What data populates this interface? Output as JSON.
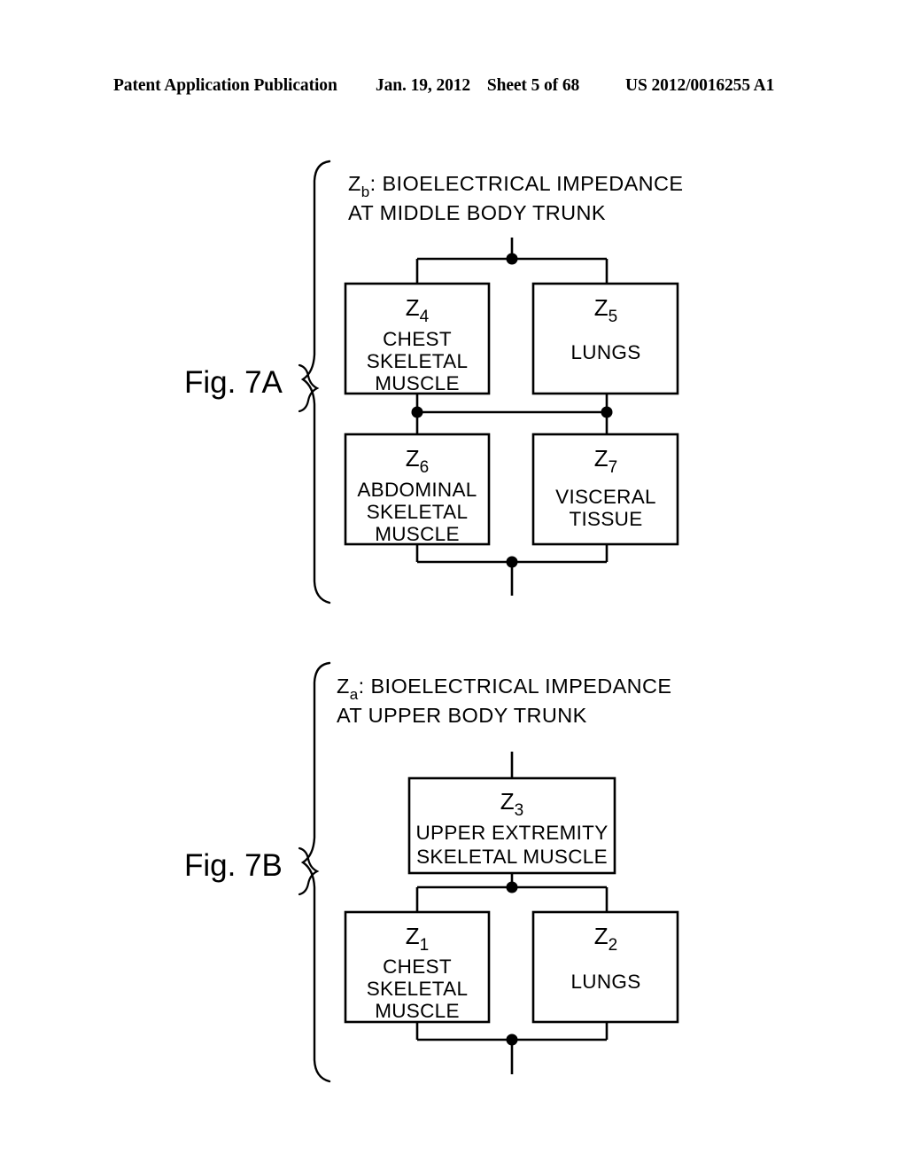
{
  "header": {
    "publication": "Patent Application Publication",
    "date": "Jan. 19, 2012",
    "sheet": "Sheet 5 of 68",
    "patent_number": "US 2012/0016255 A1"
  },
  "figures": [
    {
      "id": "fig-7a",
      "label": "Fig. 7A",
      "title_symbol": "Z",
      "title_subscript": "b",
      "title_line1": ": BIOELECTRICAL IMPEDANCE",
      "title_line2": "AT MIDDLE BODY TRUNK",
      "boxes": [
        {
          "id": "z4",
          "symbol": "Z",
          "subscript": "4",
          "lines": [
            "CHEST",
            "SKELETAL",
            "MUSCLE"
          ]
        },
        {
          "id": "z5",
          "symbol": "Z",
          "subscript": "5",
          "lines": [
            "LUNGS"
          ]
        },
        {
          "id": "z6",
          "symbol": "Z",
          "subscript": "6",
          "lines": [
            "ABDOMINAL",
            "SKELETAL",
            "MUSCLE"
          ]
        },
        {
          "id": "z7",
          "symbol": "Z",
          "subscript": "7",
          "lines": [
            "VISCERAL",
            "TISSUE"
          ]
        }
      ]
    },
    {
      "id": "fig-7b",
      "label": "Fig. 7B",
      "title_symbol": "Z",
      "title_subscript": "a",
      "title_line1": ": BIOELECTRICAL IMPEDANCE",
      "title_line2": "AT UPPER BODY TRUNK",
      "boxes": [
        {
          "id": "z3",
          "symbol": "Z",
          "subscript": "3",
          "lines": [
            "UPPER EXTREMITY",
            "SKELETAL MUSCLE"
          ]
        },
        {
          "id": "z1",
          "symbol": "Z",
          "subscript": "1",
          "lines": [
            "CHEST",
            "SKELETAL",
            "MUSCLE"
          ]
        },
        {
          "id": "z2",
          "symbol": "Z",
          "subscript": "2",
          "lines": [
            "LUNGS"
          ]
        }
      ]
    }
  ],
  "colors": {
    "ink": "#000000",
    "paper": "#ffffff"
  },
  "chart_data": {
    "type": "diagram",
    "title": "Bioelectrical impedance equivalent circuit models",
    "diagrams": [
      {
        "name": "Fig. 7A",
        "total_impedance": "Zb",
        "description": "Bioelectrical impedance at middle body trunk",
        "topology": "series of two parallel pairs",
        "elements": [
          {
            "symbol": "Z4",
            "tissue": "CHEST SKELETAL MUSCLE",
            "row": 1,
            "column": "left"
          },
          {
            "symbol": "Z5",
            "tissue": "LUNGS",
            "row": 1,
            "column": "right"
          },
          {
            "symbol": "Z6",
            "tissue": "ABDOMINAL SKELETAL MUSCLE",
            "row": 2,
            "column": "left"
          },
          {
            "symbol": "Z7",
            "tissue": "VISCERAL TISSUE",
            "row": 2,
            "column": "right"
          }
        ],
        "junction_nodes": 4
      },
      {
        "name": "Fig. 7B",
        "total_impedance": "Za",
        "description": "Bioelectrical impedance at upper body trunk",
        "topology": "single series element followed by parallel pair",
        "elements": [
          {
            "symbol": "Z3",
            "tissue": "UPPER EXTREMITY SKELETAL MUSCLE",
            "row": 1,
            "column": "center"
          },
          {
            "symbol": "Z1",
            "tissue": "CHEST SKELETAL MUSCLE",
            "row": 2,
            "column": "left"
          },
          {
            "symbol": "Z2",
            "tissue": "LUNGS",
            "row": 2,
            "column": "right"
          }
        ],
        "junction_nodes": 2
      }
    ]
  }
}
